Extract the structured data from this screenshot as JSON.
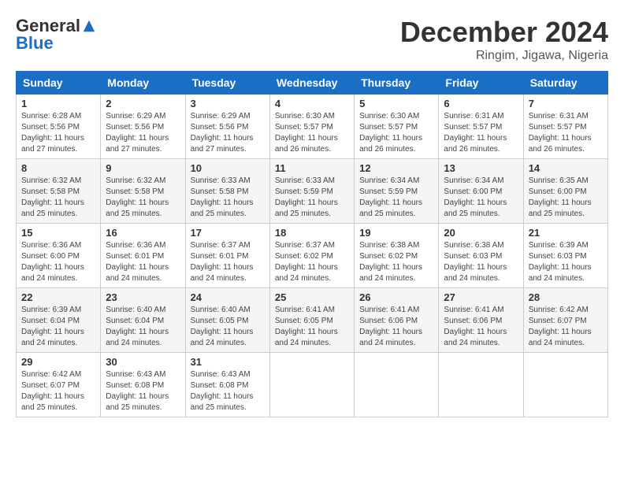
{
  "header": {
    "logo_general": "General",
    "logo_blue": "Blue",
    "month_title": "December 2024",
    "location": "Ringim, Jigawa, Nigeria"
  },
  "days_of_week": [
    "Sunday",
    "Monday",
    "Tuesday",
    "Wednesday",
    "Thursday",
    "Friday",
    "Saturday"
  ],
  "weeks": [
    [
      {
        "day": "1",
        "info": "Sunrise: 6:28 AM\nSunset: 5:56 PM\nDaylight: 11 hours\nand 27 minutes."
      },
      {
        "day": "2",
        "info": "Sunrise: 6:29 AM\nSunset: 5:56 PM\nDaylight: 11 hours\nand 27 minutes."
      },
      {
        "day": "3",
        "info": "Sunrise: 6:29 AM\nSunset: 5:56 PM\nDaylight: 11 hours\nand 27 minutes."
      },
      {
        "day": "4",
        "info": "Sunrise: 6:30 AM\nSunset: 5:57 PM\nDaylight: 11 hours\nand 26 minutes."
      },
      {
        "day": "5",
        "info": "Sunrise: 6:30 AM\nSunset: 5:57 PM\nDaylight: 11 hours\nand 26 minutes."
      },
      {
        "day": "6",
        "info": "Sunrise: 6:31 AM\nSunset: 5:57 PM\nDaylight: 11 hours\nand 26 minutes."
      },
      {
        "day": "7",
        "info": "Sunrise: 6:31 AM\nSunset: 5:57 PM\nDaylight: 11 hours\nand 26 minutes."
      }
    ],
    [
      {
        "day": "8",
        "info": "Sunrise: 6:32 AM\nSunset: 5:58 PM\nDaylight: 11 hours\nand 25 minutes."
      },
      {
        "day": "9",
        "info": "Sunrise: 6:32 AM\nSunset: 5:58 PM\nDaylight: 11 hours\nand 25 minutes."
      },
      {
        "day": "10",
        "info": "Sunrise: 6:33 AM\nSunset: 5:58 PM\nDaylight: 11 hours\nand 25 minutes."
      },
      {
        "day": "11",
        "info": "Sunrise: 6:33 AM\nSunset: 5:59 PM\nDaylight: 11 hours\nand 25 minutes."
      },
      {
        "day": "12",
        "info": "Sunrise: 6:34 AM\nSunset: 5:59 PM\nDaylight: 11 hours\nand 25 minutes."
      },
      {
        "day": "13",
        "info": "Sunrise: 6:34 AM\nSunset: 6:00 PM\nDaylight: 11 hours\nand 25 minutes."
      },
      {
        "day": "14",
        "info": "Sunrise: 6:35 AM\nSunset: 6:00 PM\nDaylight: 11 hours\nand 25 minutes."
      }
    ],
    [
      {
        "day": "15",
        "info": "Sunrise: 6:36 AM\nSunset: 6:00 PM\nDaylight: 11 hours\nand 24 minutes."
      },
      {
        "day": "16",
        "info": "Sunrise: 6:36 AM\nSunset: 6:01 PM\nDaylight: 11 hours\nand 24 minutes."
      },
      {
        "day": "17",
        "info": "Sunrise: 6:37 AM\nSunset: 6:01 PM\nDaylight: 11 hours\nand 24 minutes."
      },
      {
        "day": "18",
        "info": "Sunrise: 6:37 AM\nSunset: 6:02 PM\nDaylight: 11 hours\nand 24 minutes."
      },
      {
        "day": "19",
        "info": "Sunrise: 6:38 AM\nSunset: 6:02 PM\nDaylight: 11 hours\nand 24 minutes."
      },
      {
        "day": "20",
        "info": "Sunrise: 6:38 AM\nSunset: 6:03 PM\nDaylight: 11 hours\nand 24 minutes."
      },
      {
        "day": "21",
        "info": "Sunrise: 6:39 AM\nSunset: 6:03 PM\nDaylight: 11 hours\nand 24 minutes."
      }
    ],
    [
      {
        "day": "22",
        "info": "Sunrise: 6:39 AM\nSunset: 6:04 PM\nDaylight: 11 hours\nand 24 minutes."
      },
      {
        "day": "23",
        "info": "Sunrise: 6:40 AM\nSunset: 6:04 PM\nDaylight: 11 hours\nand 24 minutes."
      },
      {
        "day": "24",
        "info": "Sunrise: 6:40 AM\nSunset: 6:05 PM\nDaylight: 11 hours\nand 24 minutes."
      },
      {
        "day": "25",
        "info": "Sunrise: 6:41 AM\nSunset: 6:05 PM\nDaylight: 11 hours\nand 24 minutes."
      },
      {
        "day": "26",
        "info": "Sunrise: 6:41 AM\nSunset: 6:06 PM\nDaylight: 11 hours\nand 24 minutes."
      },
      {
        "day": "27",
        "info": "Sunrise: 6:41 AM\nSunset: 6:06 PM\nDaylight: 11 hours\nand 24 minutes."
      },
      {
        "day": "28",
        "info": "Sunrise: 6:42 AM\nSunset: 6:07 PM\nDaylight: 11 hours\nand 24 minutes."
      }
    ],
    [
      {
        "day": "29",
        "info": "Sunrise: 6:42 AM\nSunset: 6:07 PM\nDaylight: 11 hours\nand 25 minutes."
      },
      {
        "day": "30",
        "info": "Sunrise: 6:43 AM\nSunset: 6:08 PM\nDaylight: 11 hours\nand 25 minutes."
      },
      {
        "day": "31",
        "info": "Sunrise: 6:43 AM\nSunset: 6:08 PM\nDaylight: 11 hours\nand 25 minutes."
      },
      {
        "day": "",
        "info": ""
      },
      {
        "day": "",
        "info": ""
      },
      {
        "day": "",
        "info": ""
      },
      {
        "day": "",
        "info": ""
      }
    ]
  ]
}
